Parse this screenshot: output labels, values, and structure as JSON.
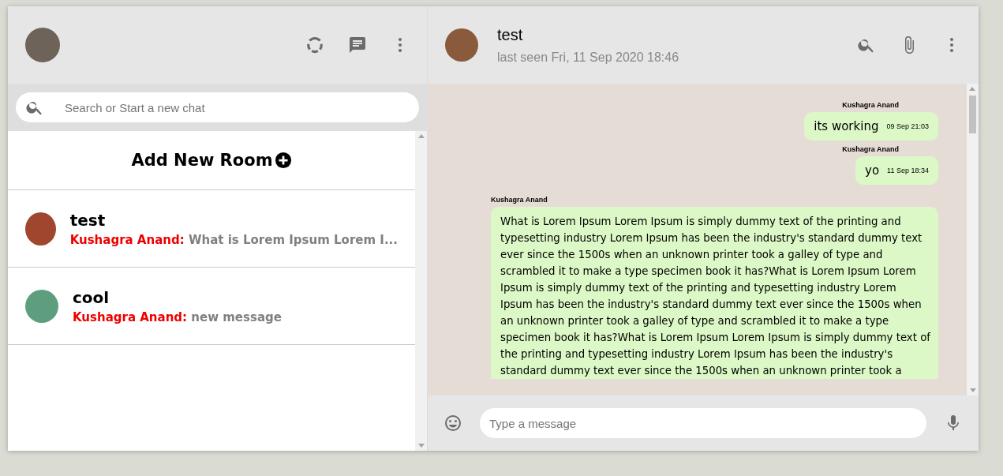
{
  "sidebar": {
    "search": {
      "placeholder": "Search or Start a new chat"
    },
    "add_room": "Add New Room",
    "chats": [
      {
        "name": "test",
        "sender": "Kushagra Anand:",
        "preview": "What is Lorem Ipsum Lorem I..."
      },
      {
        "name": "cool",
        "sender": "Kushagra Anand:",
        "preview": "new message"
      }
    ]
  },
  "chat": {
    "title": "test",
    "last_seen": "last seen Fri, 11 Sep 2020 18:46",
    "messages": [
      {
        "sender": "Kushagra Anand",
        "text": "its working",
        "time": "09 Sep 21:03",
        "kind": "own"
      },
      {
        "sender": "Kushagra Anand",
        "text": "yo",
        "time": "11 Sep 18:34",
        "kind": "own"
      },
      {
        "sender": "Kushagra Anand",
        "text": "What is Lorem Ipsum Lorem Ipsum is simply dummy text of the printing and typesetting industry Lorem Ipsum has been the industry's standard dummy text ever since the 1500s when an unknown printer took a galley of type and scrambled it to make a type specimen book it has?What is Lorem Ipsum Lorem Ipsum is simply dummy text of the printing and typesetting industry Lorem Ipsum has been the industry's standard dummy text ever since the 1500s when an unknown printer took a galley of type and scrambled it to make a type specimen book it has?What is Lorem Ipsum Lorem Ipsum is simply dummy text of the printing and typesetting industry Lorem Ipsum has been the industry's standard dummy text ever since the 1500s when an unknown printer took a",
        "kind": "long"
      }
    ],
    "composer": {
      "placeholder": "Type a message"
    }
  }
}
